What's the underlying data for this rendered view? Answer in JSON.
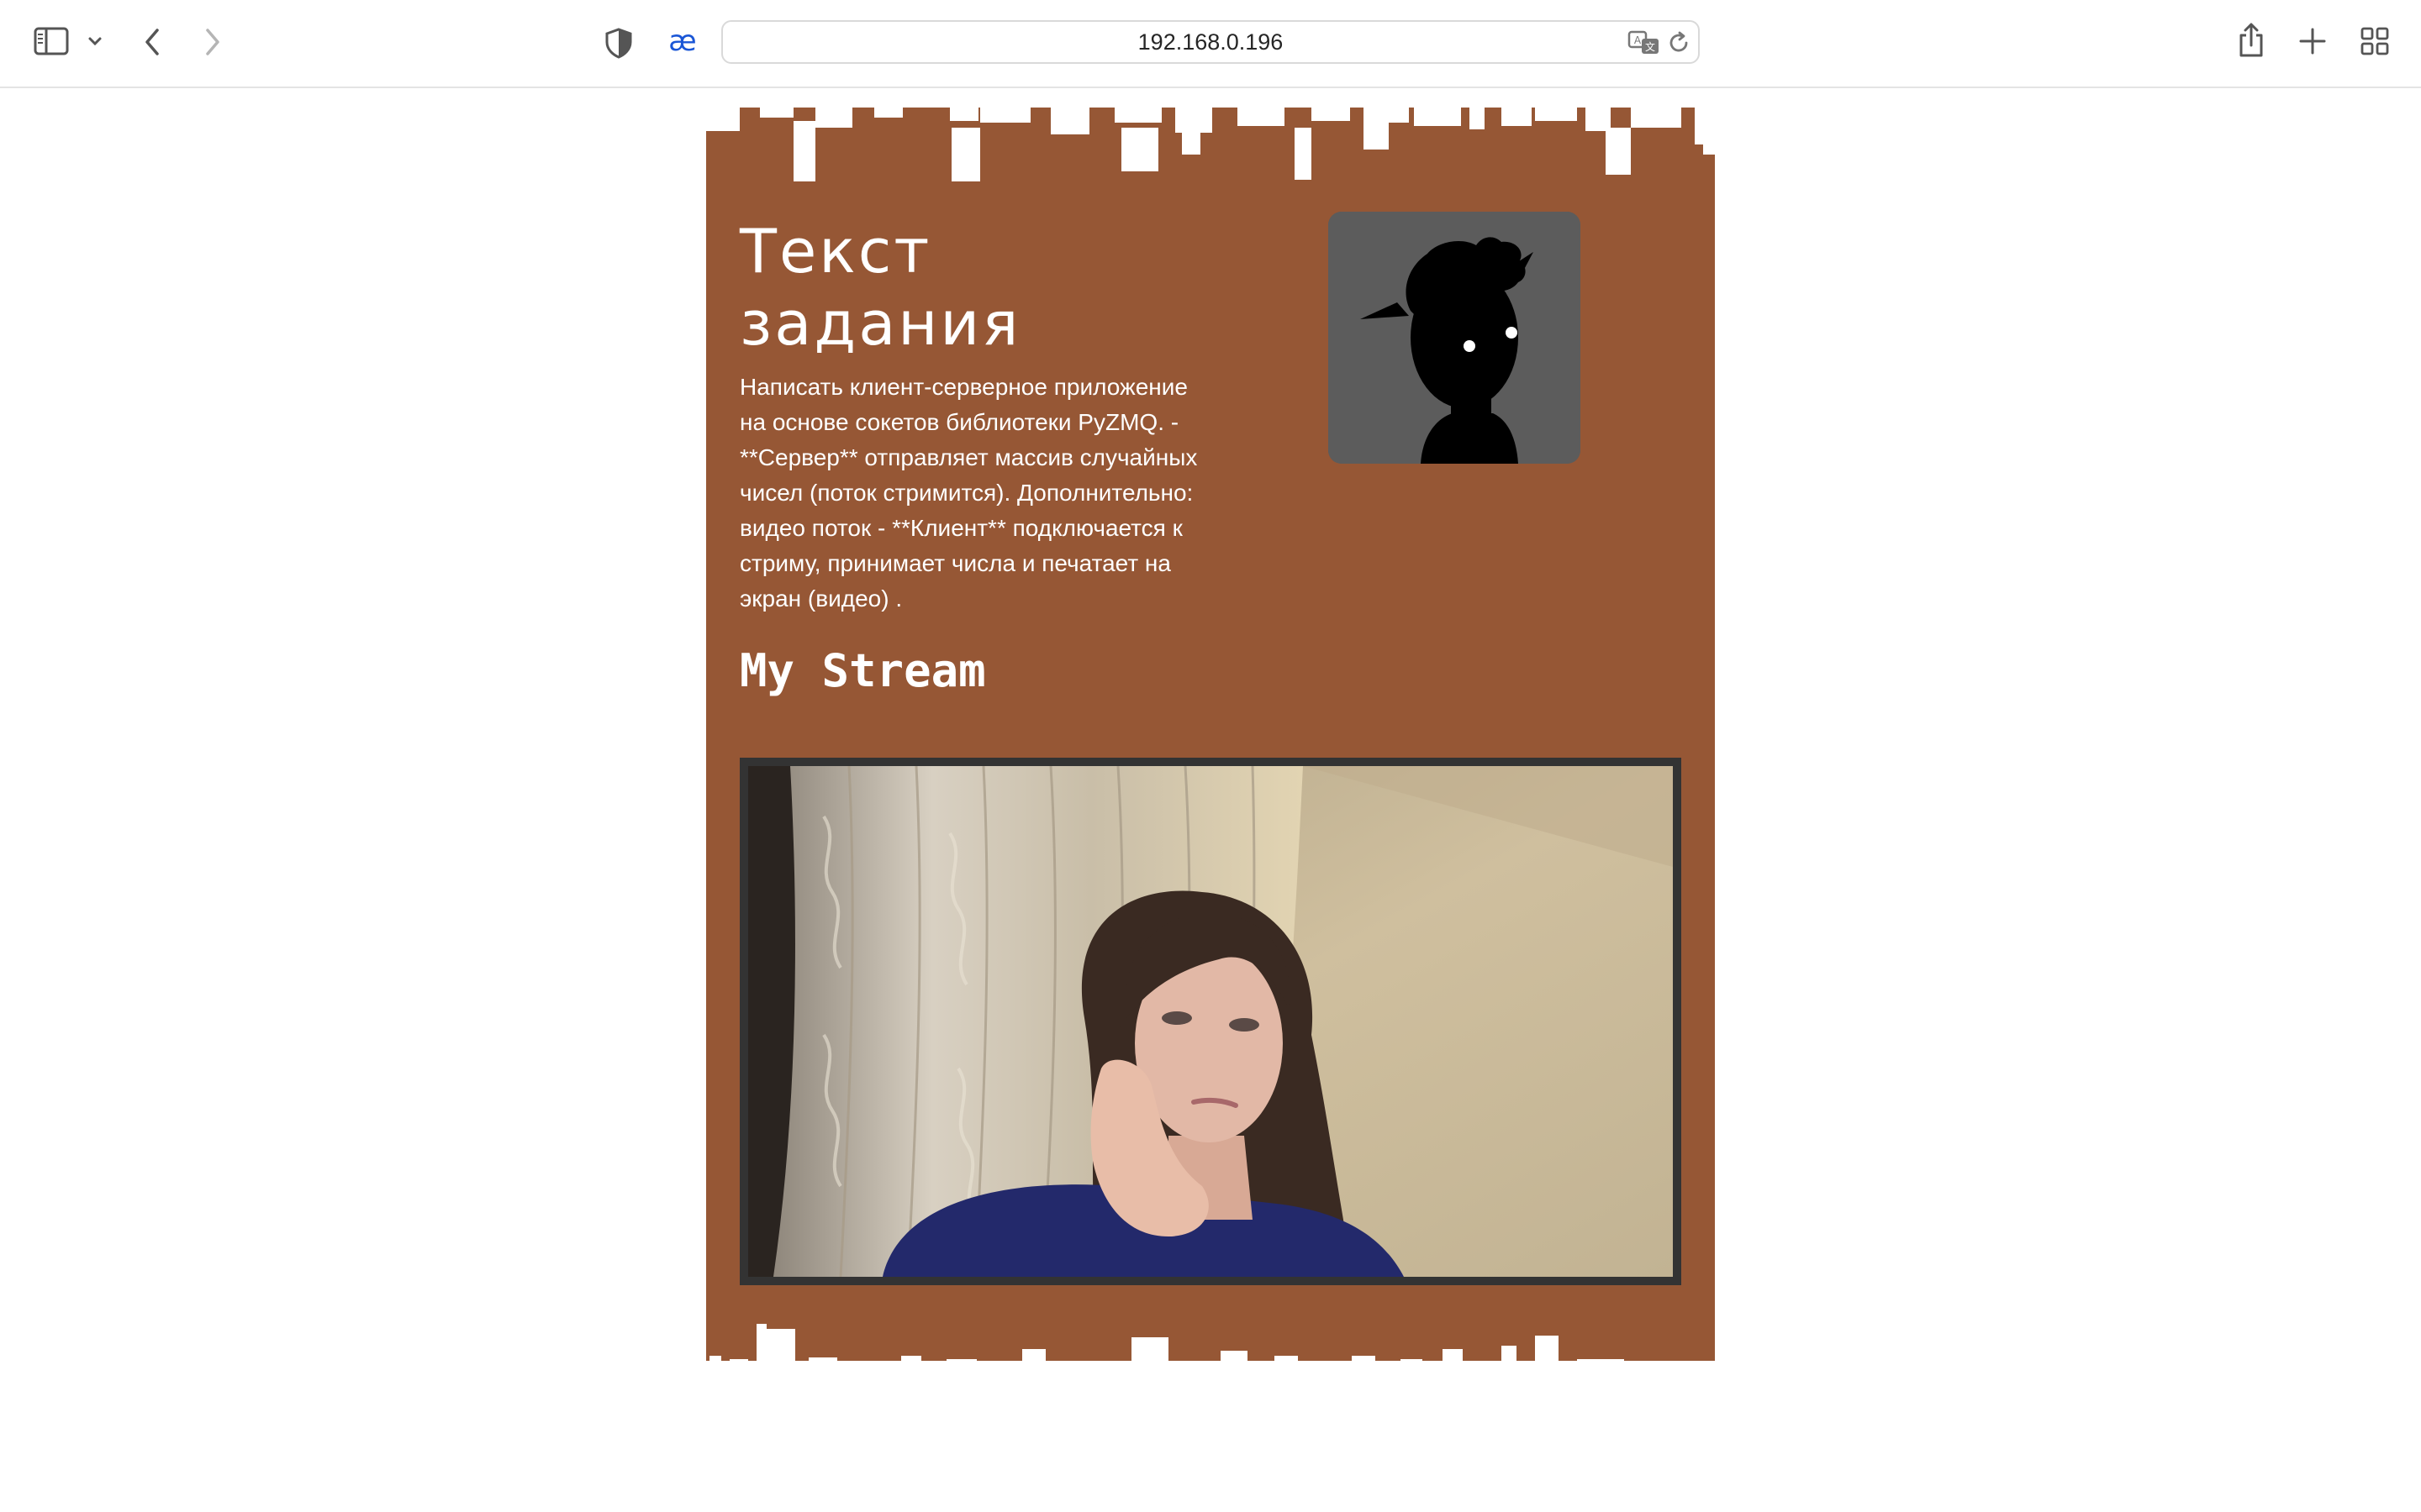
{
  "browser": {
    "url": "192.168.0.196",
    "icons": {
      "sidebar": "sidebar-icon",
      "sidebar_menu": "chevron-down-icon",
      "back": "chevron-left-icon",
      "forward": "chevron-right-icon",
      "privacy": "shield-icon",
      "extension": "ae-extension-icon",
      "translate": "translate-icon",
      "reload": "reload-icon",
      "share": "share-icon",
      "new_tab": "plus-icon",
      "tab_overview": "grid-icon"
    }
  },
  "page": {
    "title": "Текст задания",
    "description": "Написать клиент-серверное приложение на основе сокетов библиотеки PyZMQ. - **Сервер** отправляет массив случайных чисел (поток стримится). Дополнительно: видео поток - **Клиент** подключается к стриму, принимает числа и печатает на экран (видео) .",
    "stream_title": "My Stream",
    "avatar": "silhouette-avatar",
    "video": "webcam-stream"
  },
  "colors": {
    "card_brown": "#965735",
    "avatar_bg": "#5c5c5c",
    "video_border": "#333333",
    "accent_blue": "#1a56d6"
  }
}
